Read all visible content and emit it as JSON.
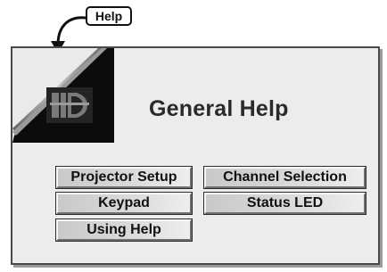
{
  "callout": {
    "label": "Help"
  },
  "window": {
    "title": "General Help",
    "logo_icon": "ild-logo-icon"
  },
  "menu": {
    "projector_setup": "Projector Setup",
    "channel_selection": "Channel Selection",
    "keypad": "Keypad",
    "status_led": "Status LED",
    "using_help": "Using Help"
  }
}
